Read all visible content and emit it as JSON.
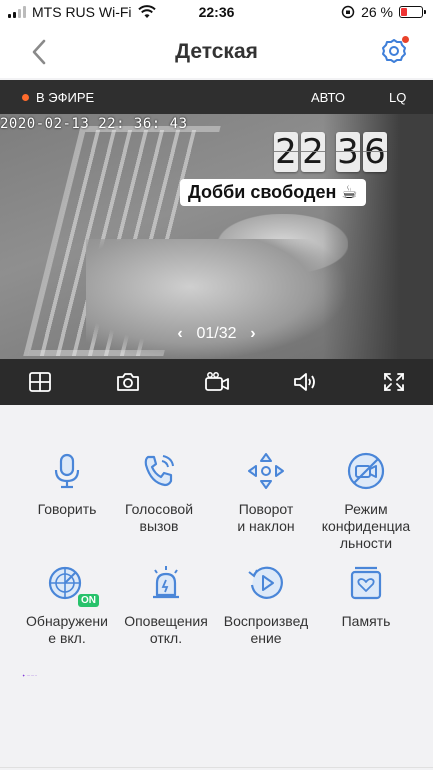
{
  "status_bar": {
    "carrier": "MTS RUS Wi-Fi",
    "time": "22:36",
    "battery_percent": "26 %",
    "battery_level": 0.26
  },
  "header": {
    "title": "Детская",
    "back_icon": "chevron-left-icon",
    "settings_icon": "gear-icon",
    "accent_color": "#3f7fd9"
  },
  "live_bar": {
    "live_label": "В ЭФИРЕ",
    "mode_label": "АВТО",
    "quality_label": "LQ"
  },
  "video": {
    "timestamp": "2020-02-13  22: 36: 43",
    "clock_digits": [
      "2",
      "2",
      "3",
      "6"
    ],
    "caption": "Добби свободен ☕",
    "pager": "01/32",
    "pager_prev": "‹",
    "pager_next": "›"
  },
  "toolbar": [
    {
      "icon": "grid-icon"
    },
    {
      "icon": "camera-icon"
    },
    {
      "icon": "video-record-icon"
    },
    {
      "icon": "volume-icon"
    },
    {
      "icon": "fullscreen-icon"
    }
  ],
  "features": [
    {
      "label": "Говорить",
      "icon": "microphone-icon"
    },
    {
      "label": "Голосовой\nвызов",
      "icon": "phone-call-icon"
    },
    {
      "label": "Поворот\nи наклон",
      "icon": "pan-tilt-icon"
    },
    {
      "label": "Режим\nконфиденциа\nльности",
      "icon": "privacy-camera-off-icon"
    },
    {
      "label": "Обнаружени\nе вкл.",
      "icon": "motion-detection-icon",
      "badge": "ON"
    },
    {
      "label": "Оповещения\nоткл.",
      "icon": "alarm-siren-icon"
    },
    {
      "label": "Воспроизвед\nение",
      "icon": "playback-icon"
    },
    {
      "label": "Память",
      "icon": "memory-album-icon"
    }
  ]
}
